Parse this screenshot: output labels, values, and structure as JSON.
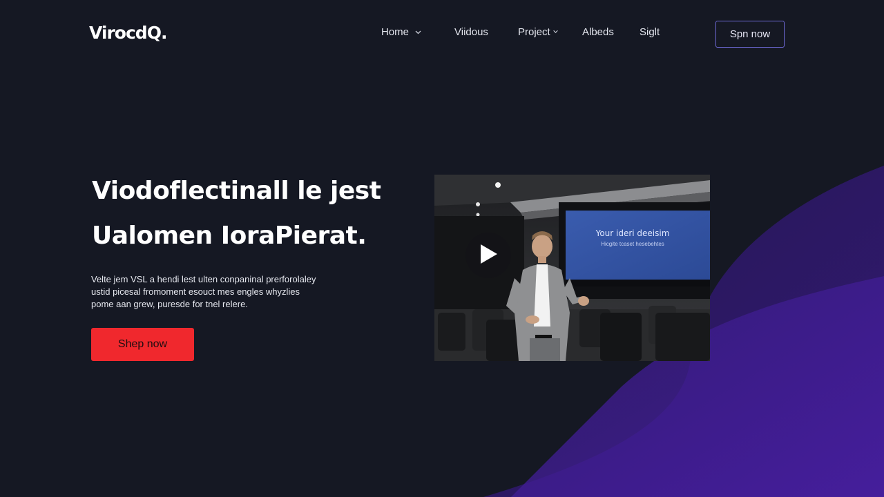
{
  "brand": {
    "logo": "VirocdQ."
  },
  "nav": {
    "items": [
      {
        "label": "Home",
        "has_dropdown": true
      },
      {
        "label": "Viidous",
        "has_dropdown": false
      },
      {
        "label": "Project",
        "has_dropdown": true
      },
      {
        "label": "Albeds",
        "has_dropdown": false
      },
      {
        "label": "Siglt",
        "has_dropdown": false
      }
    ],
    "signup_label": "Spn now"
  },
  "hero": {
    "title_line1": "Viodoflectinall le jest",
    "title_line2": "Ualomen IoraPierat.",
    "description_lines": [
      "Velte jem VSL a hendi lest ulten conpaninal prerforolaley",
      "ustid picesal fromoment esouct mes engles whyzlies",
      "pome aan grew, puresde for tnel relere."
    ],
    "cta_label": "Shep now"
  },
  "video": {
    "screen_title": "Your ideri deeisim",
    "screen_subtitle": "Hicgite tcaset hesebehtes"
  },
  "colors": {
    "background": "#151823",
    "accent_red": "#f0282d",
    "accent_purple": "#6f6ad8",
    "wave_purple": "#3b1a86"
  }
}
